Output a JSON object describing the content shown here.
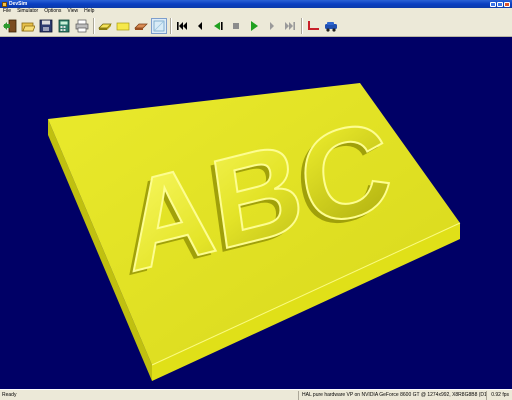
{
  "window": {
    "title": "DevSim"
  },
  "menu": {
    "items": [
      "File",
      "Simulator",
      "Options",
      "View",
      "Help"
    ]
  },
  "toolbar": {
    "buttons": [
      {
        "name": "exit-button",
        "icon": "exit-door-icon"
      },
      {
        "name": "open-button",
        "icon": "folder-open-icon"
      },
      {
        "name": "save-button",
        "icon": "floppy-disk-icon"
      },
      {
        "name": "calculator-button",
        "icon": "calculator-icon"
      },
      {
        "name": "print-button",
        "icon": "printer-icon"
      },
      {
        "name": "stock-button",
        "icon": "stock-block-icon"
      },
      {
        "name": "yellow-block-button",
        "icon": "yellow-block-icon"
      },
      {
        "name": "tool-button",
        "icon": "tool-icon"
      },
      {
        "name": "view-button",
        "icon": "view-frame-icon"
      },
      {
        "name": "rewind-button",
        "icon": "skip-to-start-icon"
      },
      {
        "name": "step-back-button",
        "icon": "step-back-icon"
      },
      {
        "name": "play-reverse-button",
        "icon": "play-reverse-icon"
      },
      {
        "name": "stop-button",
        "icon": "stop-icon"
      },
      {
        "name": "play-button",
        "icon": "play-icon"
      },
      {
        "name": "step-forward-button",
        "icon": "step-forward-icon"
      },
      {
        "name": "skip-to-end-button",
        "icon": "skip-to-end-icon"
      },
      {
        "name": "toolpath-button",
        "icon": "toolpath-icon"
      },
      {
        "name": "machine-button",
        "icon": "machine-icon"
      }
    ]
  },
  "scene": {
    "background": "#000066",
    "plate_color": "#e6e61e",
    "engraved_text": "ABC"
  },
  "status": {
    "left": "Ready",
    "renderer": "HAL pure hardware VP on NVIDIA GeForce 8600 GT @ 1274x992, X8R8G8B8 (D16)",
    "fps": "0.92 fps"
  }
}
